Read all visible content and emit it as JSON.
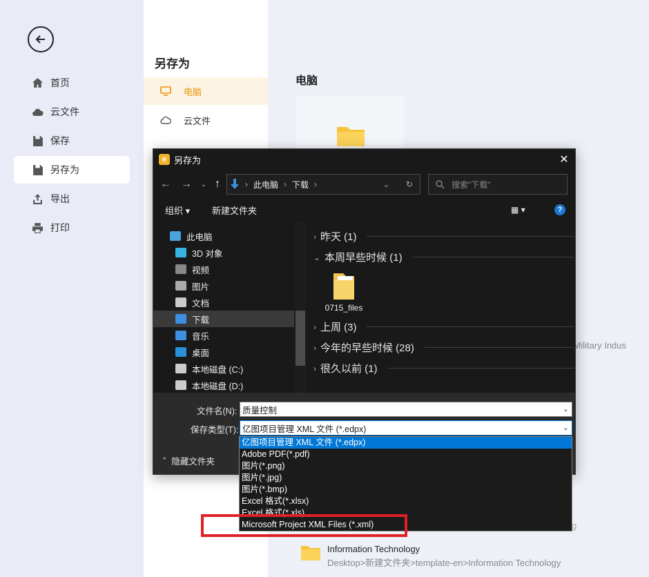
{
  "sidebar": {
    "items": [
      {
        "label": "首页",
        "icon": "home-icon"
      },
      {
        "label": "云文件",
        "icon": "cloud-icon"
      },
      {
        "label": "保存",
        "icon": "save-icon"
      },
      {
        "label": "另存为",
        "icon": "save-as-icon",
        "active": true
      },
      {
        "label": "导出",
        "icon": "export-icon"
      },
      {
        "label": "打印",
        "icon": "print-icon"
      }
    ]
  },
  "middle": {
    "title": "另存为",
    "items": [
      {
        "label": "电脑",
        "icon": "monitor-icon",
        "active": true
      },
      {
        "label": "云文件",
        "icon": "cloud-icon"
      }
    ]
  },
  "content": {
    "title": "电脑",
    "bg_path_partial": "te>Military Indus",
    "bg_path_partial2": "g",
    "recent": {
      "name": "Information Technology",
      "path": "Desktop>新建文件夹>template-en>Information Technology"
    }
  },
  "dialog": {
    "title": "另存为",
    "address": [
      "此电脑",
      "下载"
    ],
    "search_placeholder": "搜索\"下载\"",
    "toolbar": {
      "organize": "组织",
      "new_folder": "新建文件夹"
    },
    "tree": [
      {
        "label": "此电脑",
        "icon": "pc-icon",
        "color": "#4aa3df"
      },
      {
        "label": "3D 对象",
        "icon": "cube-icon",
        "color": "#36b4e0"
      },
      {
        "label": "视频",
        "icon": "video-icon",
        "color": "#888888"
      },
      {
        "label": "图片",
        "icon": "picture-icon",
        "color": "#aaaaaa"
      },
      {
        "label": "文档",
        "icon": "document-icon",
        "color": "#cccccc"
      },
      {
        "label": "下载",
        "icon": "download-icon",
        "color": "#3d8fe0",
        "selected": true
      },
      {
        "label": "音乐",
        "icon": "music-icon",
        "color": "#3d8fe0"
      },
      {
        "label": "桌面",
        "icon": "desktop-icon",
        "color": "#2a8fd8"
      },
      {
        "label": "本地磁盘 (C:)",
        "icon": "drive-c-icon",
        "color": "#cccccc"
      },
      {
        "label": "本地磁盘 (D:)",
        "icon": "drive-d-icon",
        "color": "#cccccc"
      }
    ],
    "groups": [
      {
        "label": "昨天 (1)",
        "expanded": false
      },
      {
        "label": "本周早些时候 (1)",
        "expanded": true
      },
      {
        "label": "上周 (3)",
        "expanded": false
      },
      {
        "label": "今年的早些时候 (28)",
        "expanded": false
      },
      {
        "label": "很久以前 (1)",
        "expanded": false
      }
    ],
    "file": {
      "name": "0715_files"
    },
    "filename_label": "文件名(N):",
    "filename_value": "质量控制",
    "filetype_label": "保存类型(T):",
    "filetype_value": "亿图项目管理 XML 文件 (*.edpx)",
    "hide_folders": "隐藏文件夹",
    "filetype_options": [
      "亿图项目管理 XML 文件 (*.edpx)",
      "Adobe PDF(*.pdf)",
      "图片(*.png)",
      "图片(*.jpg)",
      "图片(*.bmp)",
      "Excel 格式(*.xlsx)",
      "Excel 格式(*.xls)",
      "Microsoft Project XML Files (*.xml)"
    ]
  },
  "colors": {
    "accent_orange": "#e8930b",
    "selection_blue": "#0078d7",
    "highlight_red": "#e01f26"
  }
}
